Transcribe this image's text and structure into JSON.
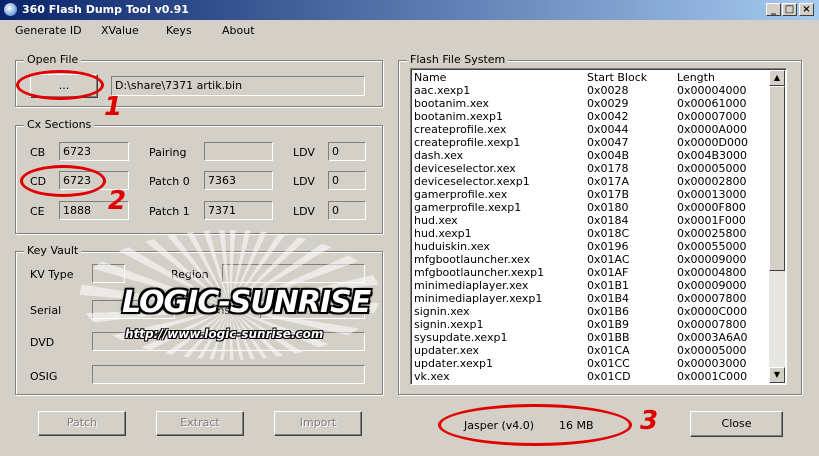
{
  "window": {
    "title": "360 Flash Dump Tool  v0.91"
  },
  "menu": [
    "Generate ID",
    "XValue",
    "Keys",
    "About"
  ],
  "open_file": {
    "label": "Open File",
    "browse_label": "...",
    "path": "D:\\share\\7371 artik.bin"
  },
  "cx_sections": {
    "label": "Cx Sections",
    "cb_label": "CB",
    "cb_value": "6723",
    "cd_label": "CD",
    "cd_value": "6723",
    "ce_label": "CE",
    "ce_value": "1888",
    "pairing_label": "Pairing",
    "pairing_value": "",
    "patch0_label": "Patch 0",
    "patch0_value": "7363",
    "patch1_label": "Patch 1",
    "patch1_value": "7371",
    "ldv_label": "LDV",
    "ldv1_value": "0",
    "ldv2_value": "0",
    "ldv3_value": "0"
  },
  "key_vault": {
    "label": "Key Vault",
    "kv_type_label": "KV Type",
    "kv_type_value": "",
    "region_label": "Region",
    "region_value": "",
    "serial_label": "Serial",
    "serial_value": "",
    "console_label": "Console",
    "console_value": "",
    "dvd_label": "DVD",
    "dvd_value": "",
    "osig_label": "OSIG",
    "osig_value": ""
  },
  "flash_fs": {
    "label": "Flash File System",
    "columns": [
      "Name",
      "Start Block",
      "Length"
    ],
    "rows": [
      [
        "aac.xexp1",
        "0x0028",
        "0x00004000"
      ],
      [
        "bootanim.xex",
        "0x0029",
        "0x00061000"
      ],
      [
        "bootanim.xexp1",
        "0x0042",
        "0x00007000"
      ],
      [
        "createprofile.xex",
        "0x0044",
        "0x0000A000"
      ],
      [
        "createprofile.xexp1",
        "0x0047",
        "0x0000D000"
      ],
      [
        "dash.xex",
        "0x004B",
        "0x004B3000"
      ],
      [
        "deviceselector.xex",
        "0x0178",
        "0x00005000"
      ],
      [
        "deviceselector.xexp1",
        "0x017A",
        "0x00002800"
      ],
      [
        "gamerprofile.xex",
        "0x017B",
        "0x00013000"
      ],
      [
        "gamerprofile.xexp1",
        "0x0180",
        "0x0000F800"
      ],
      [
        "hud.xex",
        "0x0184",
        "0x0001F000"
      ],
      [
        "hud.xexp1",
        "0x018C",
        "0x00025800"
      ],
      [
        "huduiskin.xex",
        "0x0196",
        "0x00055000"
      ],
      [
        "mfgbootlauncher.xex",
        "0x01AC",
        "0x00009000"
      ],
      [
        "mfgbootlauncher.xexp1",
        "0x01AF",
        "0x00004800"
      ],
      [
        "minimediaplayer.xex",
        "0x01B1",
        "0x00009000"
      ],
      [
        "minimediaplayer.xexp1",
        "0x01B4",
        "0x00007800"
      ],
      [
        "signin.xex",
        "0x01B6",
        "0x0000C000"
      ],
      [
        "signin.xexp1",
        "0x01B9",
        "0x00007800"
      ],
      [
        "sysupdate.xexp1",
        "0x01BB",
        "0x0003A6A0"
      ],
      [
        "updater.xex",
        "0x01CA",
        "0x00005000"
      ],
      [
        "updater.xexp1",
        "0x01CC",
        "0x00003000"
      ],
      [
        "vk.xex",
        "0x01CD",
        "0x0001C000"
      ]
    ]
  },
  "buttons": {
    "patch": "Patch",
    "extract": "Extract",
    "import": "Import",
    "close": "Close"
  },
  "status": {
    "model": "Jasper (v4.0)",
    "size": "16 MB"
  },
  "annotations": {
    "n1": "1",
    "n2": "2",
    "n3": "3",
    "color": "#e00000"
  },
  "watermark": {
    "logo": "LOGIC-SUNRISE",
    "url": "http://www.logic-sunrise.com"
  }
}
